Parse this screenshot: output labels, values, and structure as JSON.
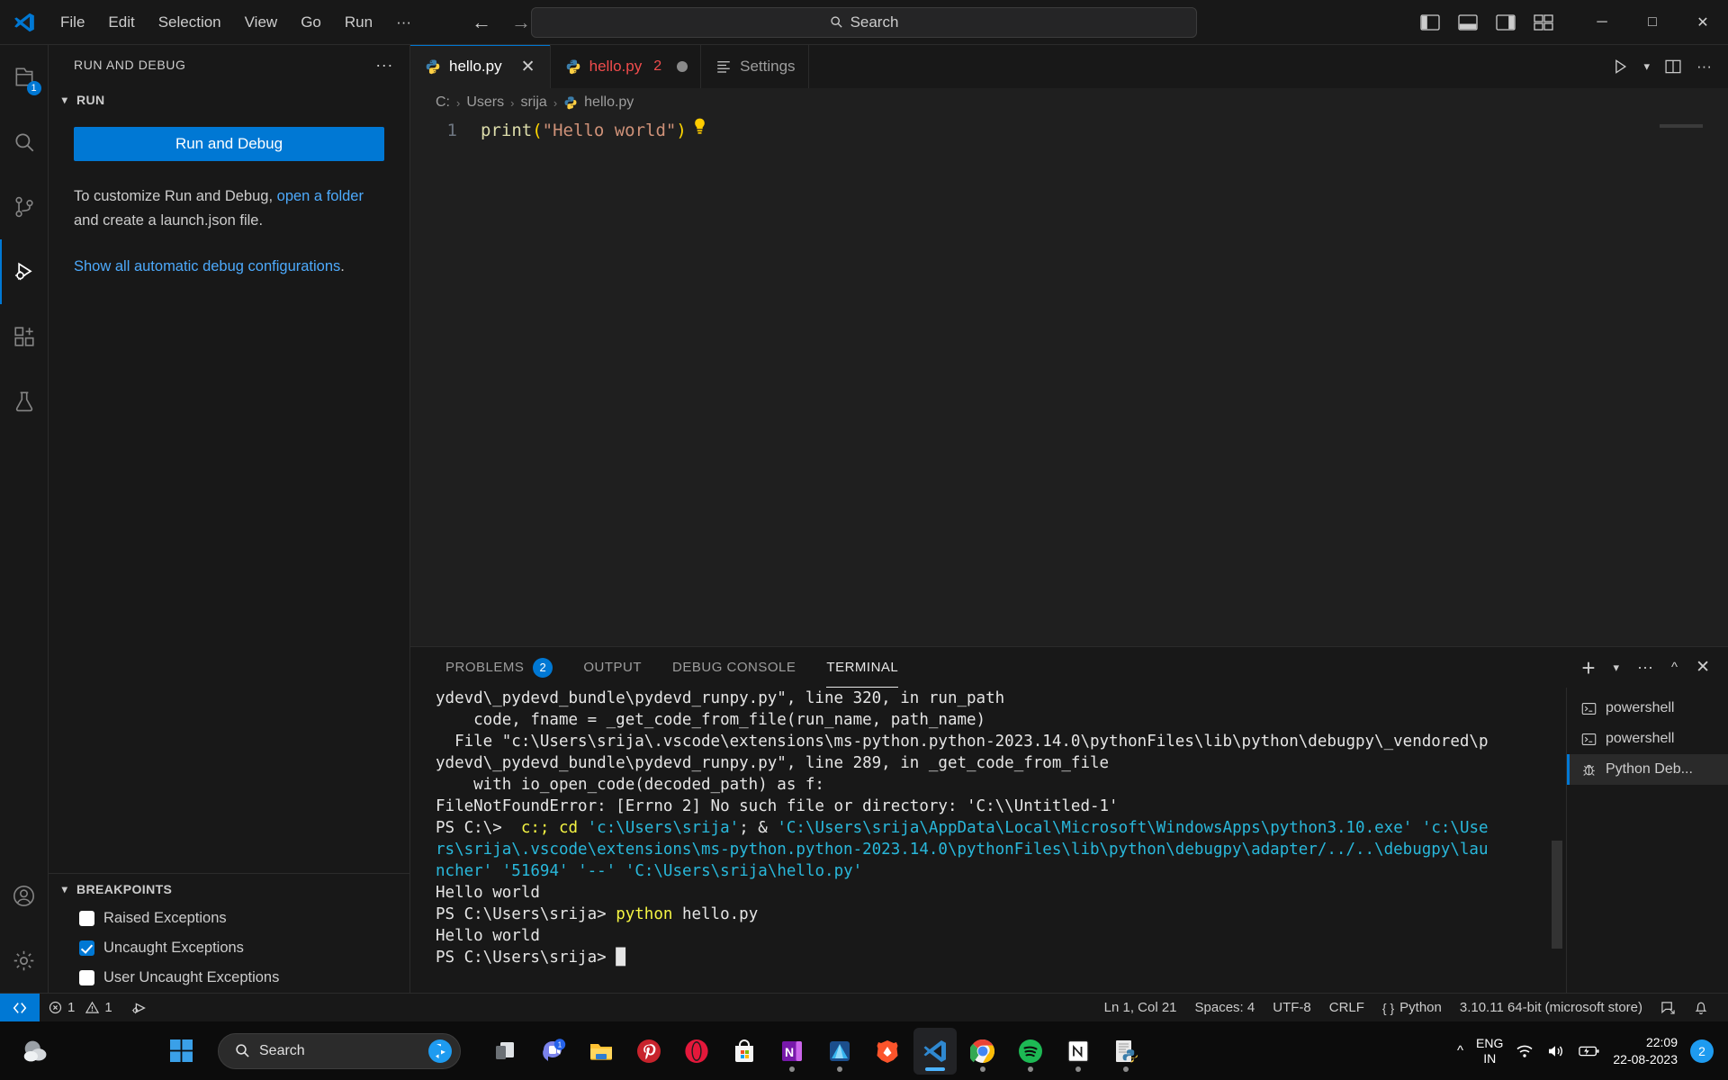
{
  "titlebar": {
    "menus": [
      "File",
      "Edit",
      "Selection",
      "View",
      "Go",
      "Run",
      "···"
    ],
    "search_placeholder": "Search",
    "back_icon": "arrow-left-icon",
    "forward_icon": "arrow-right-icon",
    "layout_icons": [
      "toggle-primary-sidebar-icon",
      "toggle-panel-icon",
      "toggle-secondary-sidebar-icon",
      "customize-layout-icon"
    ],
    "window_minimize": "─",
    "window_maximize": "□",
    "window_close": "✕"
  },
  "activitybar": {
    "items": [
      {
        "name": "explorer",
        "badge": "1"
      },
      {
        "name": "search",
        "badge": ""
      },
      {
        "name": "source-control",
        "badge": ""
      },
      {
        "name": "run-and-debug",
        "badge": "",
        "active": true
      },
      {
        "name": "extensions",
        "badge": ""
      },
      {
        "name": "testing",
        "badge": ""
      }
    ],
    "bottom": [
      {
        "name": "accounts"
      },
      {
        "name": "settings-gear"
      }
    ]
  },
  "sidebar": {
    "title": "RUN AND DEBUG",
    "more_actions": "···",
    "run_section": {
      "header": "RUN",
      "button_label": "Run and Debug",
      "note_prefix": "To customize Run and Debug, ",
      "note_link1": "open a folder",
      "note_suffix": " and create a launch.json file.",
      "note_link2": "Show all automatic debug configurations",
      "note_link2_suffix": "."
    },
    "breakpoints": {
      "header": "BREAKPOINTS",
      "items": [
        {
          "label": "Raised Exceptions",
          "checked": false
        },
        {
          "label": "Uncaught Exceptions",
          "checked": true
        },
        {
          "label": "User Uncaught Exceptions",
          "checked": false
        }
      ]
    }
  },
  "editor": {
    "tabs": [
      {
        "label": "hello.py",
        "icon": "python-icon",
        "active": true,
        "dirty": false,
        "error_count": ""
      },
      {
        "label": "hello.py",
        "icon": "python-icon",
        "active": false,
        "dirty": true,
        "error_count": "2",
        "error": true
      },
      {
        "label": "Settings",
        "icon": "settings-list-icon",
        "active": false,
        "dirty": false,
        "error_count": ""
      }
    ],
    "tab_close_glyph": "✕",
    "actions": [
      "run-python-file-icon",
      "chevron-down-icon",
      "split-editor-icon",
      "more-actions-icon"
    ],
    "breadcrumbs": [
      "C:",
      "Users",
      "srija",
      "hello.py"
    ],
    "breadcrumb_separator": "›",
    "code": {
      "line_number": "1",
      "fn": "print",
      "open_paren": "(",
      "string": "\"Hello world\"",
      "close_paren": ")",
      "lightbulb": "💡"
    }
  },
  "panel": {
    "tabs": [
      {
        "label": "PROBLEMS",
        "badge": "2",
        "active": false
      },
      {
        "label": "OUTPUT",
        "badge": "",
        "active": false
      },
      {
        "label": "DEBUG CONSOLE",
        "badge": "",
        "active": false
      },
      {
        "label": "TERMINAL",
        "badge": "",
        "active": true
      }
    ],
    "actions": [
      "new-terminal-icon",
      "chevron-down-icon",
      "more-actions-icon",
      "maximize-panel-icon",
      "close-panel-icon"
    ],
    "terminal_lines": [
      {
        "segments": [
          {
            "t": "ydevd\\_pydevd_bundle\\pydevd_runpy.py\", line 320, in run_path",
            "c": "t-white"
          }
        ]
      },
      {
        "segments": [
          {
            "t": "    code, fname = _get_code_from_file(run_name, path_name)",
            "c": "t-white"
          }
        ]
      },
      {
        "segments": [
          {
            "t": "  File \"c:\\Users\\srija\\.vscode\\extensions\\ms-python.python-2023.14.0\\pythonFiles\\lib\\python\\debugpy\\_vendored\\p",
            "c": "t-white"
          }
        ]
      },
      {
        "segments": [
          {
            "t": "ydevd\\_pydevd_bundle\\pydevd_runpy.py\", line 289, in _get_code_from_file",
            "c": "t-white"
          }
        ]
      },
      {
        "segments": [
          {
            "t": "    with io_open_code(decoded_path) as f:",
            "c": "t-white"
          }
        ]
      },
      {
        "segments": [
          {
            "t": "FileNotFoundError: [Errno 2] No such file or directory: 'C:\\\\Untitled-1'",
            "c": "t-white"
          }
        ]
      },
      {
        "segments": [
          {
            "t": "PS C:\\> ",
            "c": "t-white"
          },
          {
            "t": " c:;",
            "c": "t-yellow"
          },
          {
            "t": " ",
            "c": "t-white"
          },
          {
            "t": "cd",
            "c": "t-yellow"
          },
          {
            "t": " ",
            "c": "t-white"
          },
          {
            "t": "'c:\\Users\\srija'",
            "c": "t-cyan"
          },
          {
            "t": "; & ",
            "c": "t-white"
          },
          {
            "t": "'C:\\Users\\srija\\AppData\\Local\\Microsoft\\WindowsApps\\python3.10.exe'",
            "c": "t-cyan"
          },
          {
            "t": " ",
            "c": "t-white"
          },
          {
            "t": "'c:\\Use",
            "c": "t-cyan"
          }
        ]
      },
      {
        "segments": [
          {
            "t": "rs\\srija\\.vscode\\extensions\\ms-python.python-2023.14.0\\pythonFiles\\lib\\python\\debugpy\\adapter/../..\\debugpy\\lau",
            "c": "t-cyan"
          }
        ]
      },
      {
        "segments": [
          {
            "t": "ncher'",
            "c": "t-cyan"
          },
          {
            "t": " ",
            "c": "t-white"
          },
          {
            "t": "'51694'",
            "c": "t-cyan"
          },
          {
            "t": " ",
            "c": "t-white"
          },
          {
            "t": "'--'",
            "c": "t-cyan"
          },
          {
            "t": " ",
            "c": "t-white"
          },
          {
            "t": "'C:\\Users\\srija\\hello.py'",
            "c": "t-cyan"
          }
        ]
      },
      {
        "segments": [
          {
            "t": "Hello world",
            "c": "t-white"
          }
        ]
      },
      {
        "segments": [
          {
            "t": "PS C:\\Users\\srija> ",
            "c": "t-white"
          },
          {
            "t": "python",
            "c": "t-yellow"
          },
          {
            "t": " hello.py",
            "c": "t-white"
          }
        ]
      },
      {
        "segments": [
          {
            "t": "Hello world",
            "c": "t-white"
          }
        ]
      },
      {
        "segments": [
          {
            "t": "PS C:\\Users\\srija> ",
            "c": "t-white"
          },
          {
            "t": "█",
            "c": "t-white"
          }
        ]
      }
    ],
    "terminal_list": [
      {
        "label": "powershell",
        "icon": "terminal-icon",
        "active": false
      },
      {
        "label": "powershell",
        "icon": "terminal-icon",
        "active": false
      },
      {
        "label": "Python Deb...",
        "icon": "debug-bug-icon",
        "active": true
      }
    ]
  },
  "statusbar": {
    "remote_icon": "remote-window-icon",
    "errors": "1",
    "warnings": "1",
    "ports_icon": "ports-icon",
    "right_items": [
      "Ln 1, Col 21",
      "Spaces: 4",
      "UTF-8",
      "CRLF",
      "Python",
      "3.10.11 64-bit (microsoft store)"
    ],
    "python_brace": "{ }",
    "feedback_icon": "feedback-icon",
    "bell_icon": "notifications-bell-icon"
  },
  "taskbar": {
    "weather_icon": "weather-cloud-icon",
    "start_icon": "windows-start-icon",
    "search_placeholder": "Search",
    "search_icon": "search-icon",
    "copilot_icon": "bing-chat-icon",
    "apps": [
      {
        "name": "task-view",
        "running": false,
        "focused": false
      },
      {
        "name": "teams-chat",
        "running": false,
        "focused": false,
        "badge": "1"
      },
      {
        "name": "file-explorer",
        "running": false,
        "focused": false
      },
      {
        "name": "pinterest",
        "running": false,
        "focused": false
      },
      {
        "name": "opera",
        "running": false,
        "focused": false
      },
      {
        "name": "microsoft-store",
        "running": false,
        "focused": false
      },
      {
        "name": "onenote",
        "running": true,
        "focused": false
      },
      {
        "name": "azure-data-studio",
        "running": true,
        "focused": false
      },
      {
        "name": "brave-browser",
        "running": false,
        "focused": false
      },
      {
        "name": "visual-studio-code",
        "running": true,
        "focused": true
      },
      {
        "name": "google-chrome",
        "running": true,
        "focused": false
      },
      {
        "name": "spotify",
        "running": true,
        "focused": false
      },
      {
        "name": "notion",
        "running": true,
        "focused": false
      },
      {
        "name": "python-idle",
        "running": true,
        "focused": false
      }
    ],
    "tray": {
      "chevron": "show-hidden-icons",
      "language_top": "ENG",
      "language_bottom": "IN",
      "wifi_icon": "wifi-icon",
      "volume_icon": "volume-icon",
      "battery_icon": "battery-charging-icon",
      "time": "22:09",
      "date": "22-08-2023",
      "notification_count": "2"
    }
  }
}
